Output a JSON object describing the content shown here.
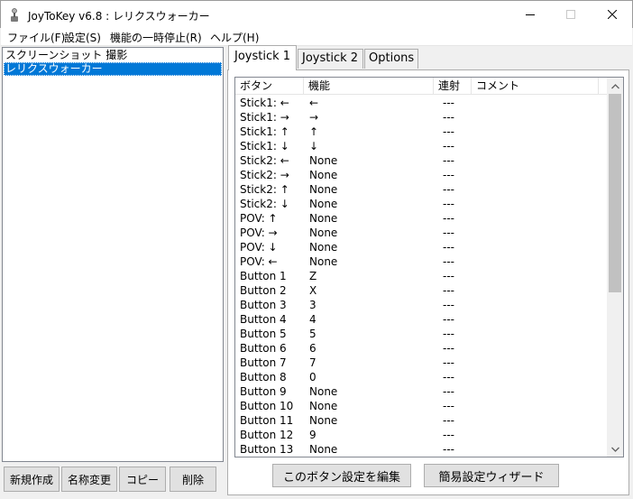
{
  "window": {
    "title": "JoyToKey v6.8 : レリクスウォーカー"
  },
  "menu": [
    {
      "label": "ファイル(F)"
    },
    {
      "label": "設定(S)"
    },
    {
      "label": "機能の一時停止(R)"
    },
    {
      "label": "ヘルプ(H)"
    }
  ],
  "configs": [
    {
      "label": "スクリーンショット 撮影",
      "selected": false
    },
    {
      "label": "レリクスウォーカー",
      "selected": true
    }
  ],
  "left_buttons": {
    "new": "新規作成",
    "rename": "名称変更",
    "copy": "コピー",
    "delete": "削除"
  },
  "tabs": [
    {
      "label": "Joystick 1",
      "active": true
    },
    {
      "label": "Joystick 2",
      "active": false
    },
    {
      "label": "Options",
      "active": false
    }
  ],
  "columns": {
    "button": "ボタン",
    "function": "機能",
    "repeat": "連射",
    "comment": "コメント"
  },
  "rows": [
    {
      "button": "Stick1: ←",
      "function": "←",
      "repeat": "---"
    },
    {
      "button": "Stick1: →",
      "function": "→",
      "repeat": "---"
    },
    {
      "button": "Stick1: ↑",
      "function": "↑",
      "repeat": "---"
    },
    {
      "button": "Stick1: ↓",
      "function": "↓",
      "repeat": "---"
    },
    {
      "button": "Stick2: ←",
      "function": "None",
      "repeat": "---"
    },
    {
      "button": "Stick2: →",
      "function": "None",
      "repeat": "---"
    },
    {
      "button": "Stick2: ↑",
      "function": "None",
      "repeat": "---"
    },
    {
      "button": "Stick2: ↓",
      "function": "None",
      "repeat": "---"
    },
    {
      "button": "POV: ↑",
      "function": "None",
      "repeat": "---"
    },
    {
      "button": "POV: →",
      "function": "None",
      "repeat": "---"
    },
    {
      "button": "POV: ↓",
      "function": "None",
      "repeat": "---"
    },
    {
      "button": "POV: ←",
      "function": "None",
      "repeat": "---"
    },
    {
      "button": "Button 1",
      "function": "Z",
      "repeat": "---"
    },
    {
      "button": "Button 2",
      "function": "X",
      "repeat": "---"
    },
    {
      "button": "Button 3",
      "function": "3",
      "repeat": "---"
    },
    {
      "button": "Button 4",
      "function": "4",
      "repeat": "---"
    },
    {
      "button": "Button 5",
      "function": "5",
      "repeat": "---"
    },
    {
      "button": "Button 6",
      "function": "6",
      "repeat": "---"
    },
    {
      "button": "Button 7",
      "function": "7",
      "repeat": "---"
    },
    {
      "button": "Button 8",
      "function": "0",
      "repeat": "---"
    },
    {
      "button": "Button 9",
      "function": "None",
      "repeat": "---"
    },
    {
      "button": "Button 10",
      "function": "None",
      "repeat": "---"
    },
    {
      "button": "Button 11",
      "function": "None",
      "repeat": "---"
    },
    {
      "button": "Button 12",
      "function": "9",
      "repeat": "---"
    },
    {
      "button": "Button 13",
      "function": "None",
      "repeat": "---"
    }
  ],
  "bottom_buttons": {
    "edit": "このボタン設定を編集",
    "wizard": "簡易設定ウィザード"
  },
  "colors": {
    "selection": "#0078d7",
    "button_face": "#e1e1e1"
  }
}
